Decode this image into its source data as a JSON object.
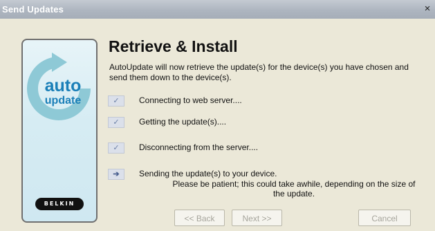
{
  "window": {
    "title": "Send Updates",
    "close_glyph": "×"
  },
  "side_panel": {
    "logo_word_1": "auto",
    "logo_word_2": "update",
    "brand": "BELKIN",
    "logo_color": "#1a7fb8",
    "ring_color": "#8ec9d6"
  },
  "main": {
    "heading": "Retrieve & Install",
    "intro": "AutoUpdate will now retrieve the update(s) for the device(s) you have chosen and send them down to the device(s).",
    "steps": [
      {
        "label": "Connecting to web server....",
        "status": "done",
        "icon": "check-icon",
        "glyph": "✓"
      },
      {
        "label": "Getting the update(s)....",
        "status": "done",
        "icon": "check-icon",
        "glyph": "✓"
      },
      {
        "label": "Disconnecting from the server....",
        "status": "done",
        "icon": "check-icon",
        "glyph": "✓"
      },
      {
        "label": "Sending the update(s) to your device.",
        "status": "current",
        "icon": "arrow-right-icon",
        "glyph": "➔"
      }
    ],
    "note": "Please be patient; this could take awhile, depending on the size of the update."
  },
  "buttons": {
    "back": "<< Back",
    "next": "Next >>",
    "cancel": "Cancel"
  }
}
